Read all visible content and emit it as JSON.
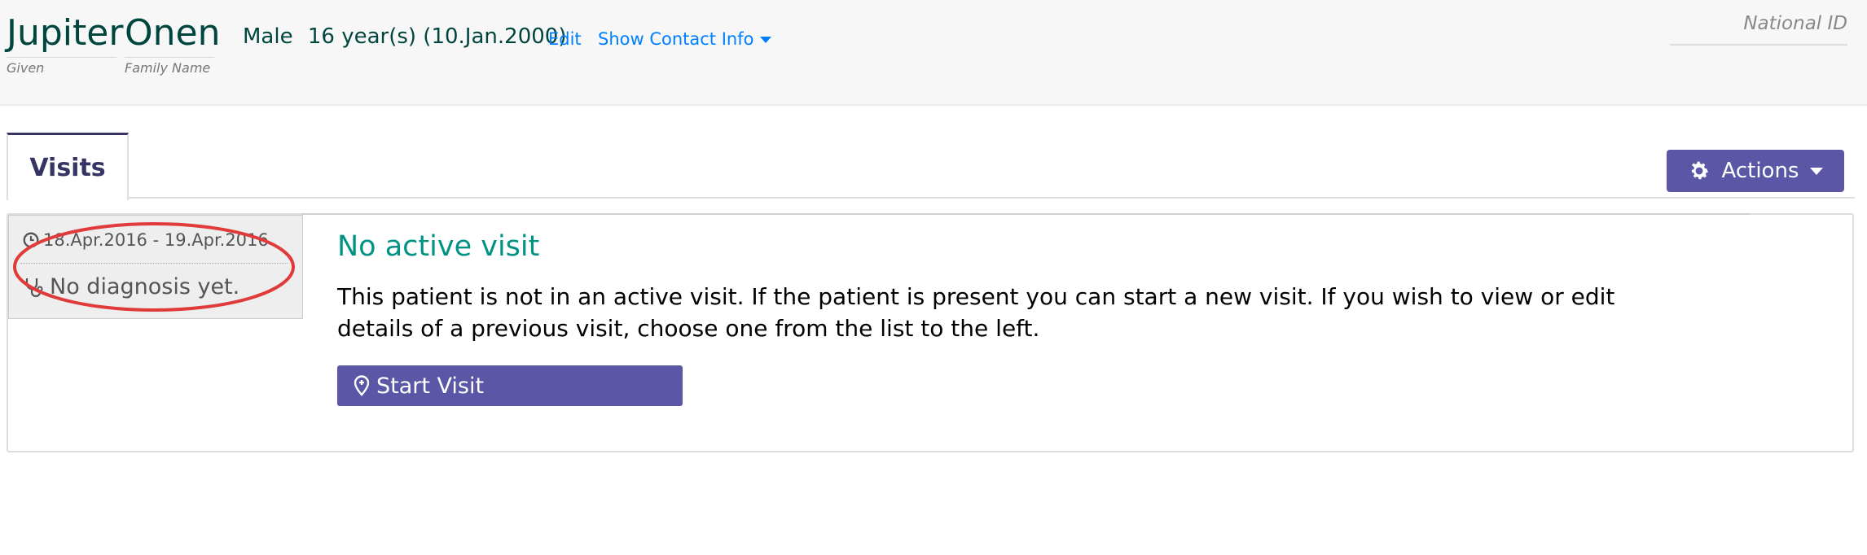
{
  "patient": {
    "given_name": "Jupiter",
    "family_name": "Onen",
    "given_label": "Given",
    "family_label": "Family Name",
    "gender": "Male",
    "age": "16 year(s) (10.Jan.2000)",
    "edit_label": "Edit",
    "contact_label": "Show Contact Info",
    "national_id_label": "National ID"
  },
  "tabs": [
    {
      "label": "Visits",
      "active": true
    }
  ],
  "actions": {
    "label": "Actions",
    "icon": "gear-icon"
  },
  "visits": [
    {
      "dates": "18.Apr.2016 - 19.Apr.2016",
      "diagnosis": "No diagnosis yet."
    }
  ],
  "main": {
    "title": "No active visit",
    "description": "This patient is not in an active visit. If the patient is present you can start a new visit. If you wish to view or edit details of a previous visit, choose one from the list to the left.",
    "start_visit_label": "Start Visit"
  },
  "colors": {
    "brand_purple": "#5b57a6",
    "name_green": "#00463f",
    "title_teal": "#009384",
    "link_blue": "#007fff",
    "annotation_red": "#e03a3a"
  }
}
